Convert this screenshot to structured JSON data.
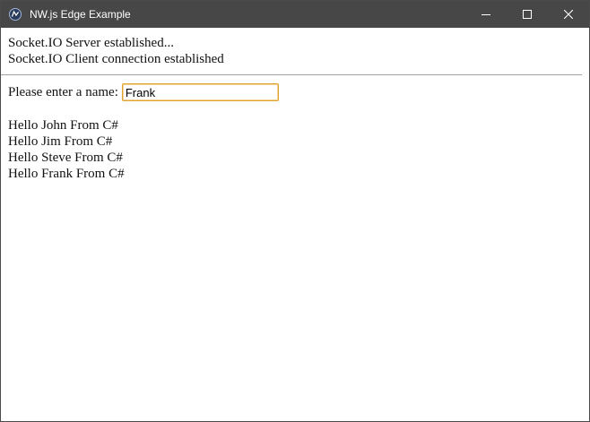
{
  "window": {
    "title": "NW.js Edge Example",
    "icon": "nwjs-logo-icon",
    "controls": {
      "minimize": "minimize-icon",
      "maximize": "maximize-icon",
      "close": "close-icon"
    }
  },
  "status": {
    "server": "Socket.IO Server established...",
    "client": "Socket.IO Client connection established"
  },
  "form": {
    "label": "Please enter a name:",
    "name_value": "Frank"
  },
  "greetings": [
    "Hello John From C#",
    "Hello Jim From C#",
    "Hello Steve From C#",
    "Hello Frank From C#"
  ],
  "colors": {
    "titlebar": "#474747",
    "input_focus_border": "#e0a32c"
  }
}
